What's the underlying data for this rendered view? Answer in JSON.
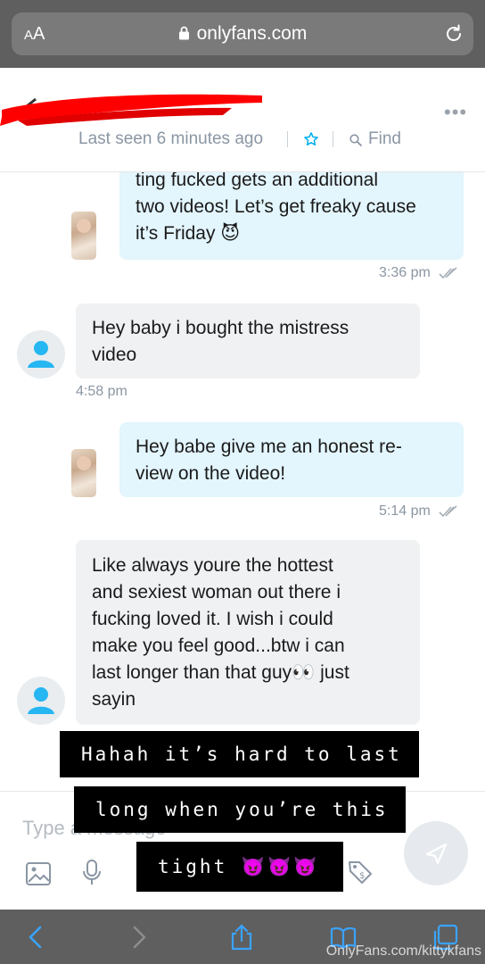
{
  "browser": {
    "text_size_label": "AA",
    "domain": "onlyfans.com",
    "icons": [
      "lock-icon",
      "reload-icon",
      "back-icon",
      "forward-icon",
      "share-icon",
      "bookmarks-icon",
      "tabs-icon"
    ]
  },
  "header": {
    "last_seen": "Last seen 6 minutes ago",
    "find_label": "Find",
    "more_label": "•••"
  },
  "messages": [
    {
      "direction": "out",
      "lines": [
        "ting fucked gets an additional",
        "two videos! Let’s get freaky cause",
        "it’s Friday 😈"
      ],
      "time": "3:36 pm"
    },
    {
      "direction": "in",
      "lines": [
        "Hey baby i bought the mistress",
        "video"
      ],
      "time": "4:58 pm"
    },
    {
      "direction": "out",
      "lines": [
        "Hey babe give me an honest re-",
        "view on the video!"
      ],
      "time": "5:14 pm"
    },
    {
      "direction": "in",
      "lines": [
        "Like always youre the hottest",
        "and sexiest woman out there i",
        "fucking loved it. I wish i could",
        "make you feel good...btw i can",
        "last longer than that guy👀 just",
        "sayin"
      ],
      "time": ""
    }
  ],
  "composer": {
    "placeholder": "Type a message"
  },
  "caption": {
    "lines": [
      "Hahah it’s hard to last",
      "long when you’re this",
      "tight 😈😈😈"
    ]
  },
  "watermark": "OnlyFans.com/kittykfans",
  "colors": {
    "accent": "#00aff0",
    "out_bubble": "#e3f5fd",
    "in_bubble": "#f0f1f3",
    "muted_text": "#8a96a3",
    "redaction": "#ff0000"
  }
}
